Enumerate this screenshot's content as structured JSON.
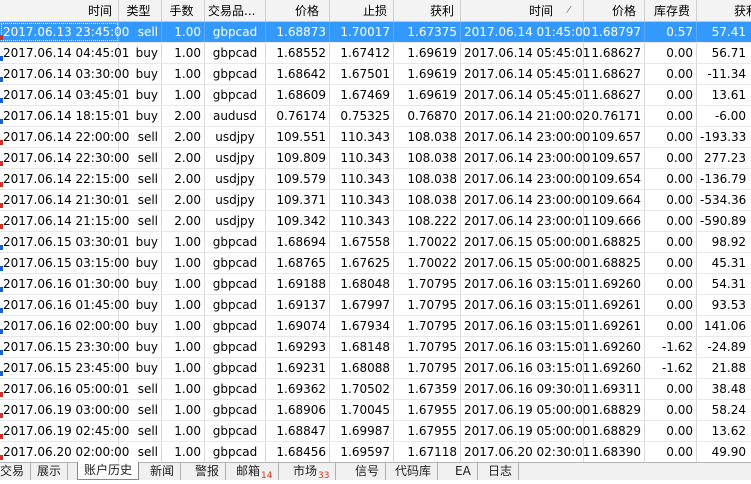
{
  "columns": [
    "时间",
    "类型",
    "手数",
    "交易品...",
    "价格",
    "止损",
    "获利",
    "时间",
    "价格",
    "库存费",
    "获利"
  ],
  "rows": [
    [
      "2017.06.13 23:45:00",
      "sell",
      "1.00",
      "gbpcad",
      "1.68873",
      "1.70017",
      "1.67375",
      "2017.06.14 01:45:00",
      "1.68797",
      "0.57",
      "57.41"
    ],
    [
      "2017.06.14 04:45:01",
      "buy",
      "1.00",
      "gbpcad",
      "1.68552",
      "1.67412",
      "1.69619",
      "2017.06.14 05:45:01",
      "1.68627",
      "0.00",
      "56.71"
    ],
    [
      "2017.06.14 03:30:00",
      "buy",
      "1.00",
      "gbpcad",
      "1.68642",
      "1.67501",
      "1.69619",
      "2017.06.14 05:45:01",
      "1.68627",
      "0.00",
      "-11.34"
    ],
    [
      "2017.06.14 03:45:01",
      "buy",
      "1.00",
      "gbpcad",
      "1.68609",
      "1.67469",
      "1.69619",
      "2017.06.14 05:45:01",
      "1.68627",
      "0.00",
      "13.61"
    ],
    [
      "2017.06.14 18:15:01",
      "buy",
      "2.00",
      "audusd",
      "0.76174",
      "0.75325",
      "0.76870",
      "2017.06.14 21:00:02",
      "0.76171",
      "0.00",
      "-6.00"
    ],
    [
      "2017.06.14 22:00:00",
      "sell",
      "2.00",
      "usdjpy",
      "109.551",
      "110.343",
      "108.038",
      "2017.06.14 23:00:00",
      "109.657",
      "0.00",
      "-193.33"
    ],
    [
      "2017.06.14 22:30:00",
      "sell",
      "2.00",
      "usdjpy",
      "109.809",
      "110.343",
      "108.038",
      "2017.06.14 23:00:00",
      "109.657",
      "0.00",
      "277.23"
    ],
    [
      "2017.06.14 22:15:00",
      "sell",
      "2.00",
      "usdjpy",
      "109.579",
      "110.343",
      "108.038",
      "2017.06.14 23:00:00",
      "109.654",
      "0.00",
      "-136.79"
    ],
    [
      "2017.06.14 21:30:01",
      "sell",
      "2.00",
      "usdjpy",
      "109.371",
      "110.343",
      "108.038",
      "2017.06.14 23:00:00",
      "109.664",
      "0.00",
      "-534.36"
    ],
    [
      "2017.06.14 21:15:00",
      "sell",
      "2.00",
      "usdjpy",
      "109.342",
      "110.343",
      "108.222",
      "2017.06.14 23:00:01",
      "109.666",
      "0.00",
      "-590.89"
    ],
    [
      "2017.06.15 03:30:01",
      "buy",
      "1.00",
      "gbpcad",
      "1.68694",
      "1.67558",
      "1.70022",
      "2017.06.15 05:00:00",
      "1.68825",
      "0.00",
      "98.92"
    ],
    [
      "2017.06.15 03:15:00",
      "buy",
      "1.00",
      "gbpcad",
      "1.68765",
      "1.67625",
      "1.70022",
      "2017.06.15 05:00:00",
      "1.68825",
      "0.00",
      "45.31"
    ],
    [
      "2017.06.16 01:30:00",
      "buy",
      "1.00",
      "gbpcad",
      "1.69188",
      "1.68048",
      "1.70795",
      "2017.06.16 03:15:01",
      "1.69260",
      "0.00",
      "54.31"
    ],
    [
      "2017.06.16 01:45:00",
      "buy",
      "1.00",
      "gbpcad",
      "1.69137",
      "1.67997",
      "1.70795",
      "2017.06.16 03:15:01",
      "1.69261",
      "0.00",
      "93.53"
    ],
    [
      "2017.06.16 02:00:00",
      "buy",
      "1.00",
      "gbpcad",
      "1.69074",
      "1.67934",
      "1.70795",
      "2017.06.16 03:15:01",
      "1.69261",
      "0.00",
      "141.06"
    ],
    [
      "2017.06.15 23:30:00",
      "buy",
      "1.00",
      "gbpcad",
      "1.69293",
      "1.68148",
      "1.70795",
      "2017.06.16 03:15:01",
      "1.69260",
      "-1.62",
      "-24.89"
    ],
    [
      "2017.06.15 23:45:00",
      "buy",
      "1.00",
      "gbpcad",
      "1.69231",
      "1.68088",
      "1.70795",
      "2017.06.16 03:15:01",
      "1.69260",
      "-1.62",
      "21.88"
    ],
    [
      "2017.06.16 05:00:01",
      "sell",
      "1.00",
      "gbpcad",
      "1.69362",
      "1.70502",
      "1.67359",
      "2017.06.16 09:30:01",
      "1.69311",
      "0.00",
      "38.48"
    ],
    [
      "2017.06.19 03:00:00",
      "sell",
      "1.00",
      "gbpcad",
      "1.68906",
      "1.70045",
      "1.67955",
      "2017.06.19 05:00:00",
      "1.68829",
      "0.00",
      "58.24"
    ],
    [
      "2017.06.19 02:45:00",
      "sell",
      "1.00",
      "gbpcad",
      "1.68847",
      "1.69987",
      "1.67955",
      "2017.06.19 05:00:00",
      "1.68829",
      "0.00",
      "13.62"
    ],
    [
      "2017.06.20 02:00:00",
      "sell",
      "1.00",
      "gbpcad",
      "1.68456",
      "1.69597",
      "1.67118",
      "2017.06.20 02:30:01",
      "1.68390",
      "0.00",
      "49.90"
    ]
  ],
  "selected_row": 0,
  "tabs": [
    {
      "label": "交易",
      "badge": ""
    },
    {
      "label": "展示",
      "badge": ""
    },
    {
      "label": "账户历史",
      "badge": ""
    },
    {
      "label": "新闻",
      "badge": ""
    },
    {
      "label": "警报",
      "badge": ""
    },
    {
      "label": "邮箱",
      "badge": "14"
    },
    {
      "label": "市场",
      "badge": "33"
    },
    {
      "label": "信号",
      "badge": ""
    },
    {
      "label": "代码库",
      "badge": ""
    },
    {
      "label": "EA",
      "badge": ""
    },
    {
      "label": "日志",
      "badge": ""
    }
  ],
  "active_tab": 2,
  "colors": {
    "selection": "#3399ff",
    "buy_marker": "#1a5fd0",
    "sell_marker": "#d0302a",
    "badge": "#e03020"
  }
}
